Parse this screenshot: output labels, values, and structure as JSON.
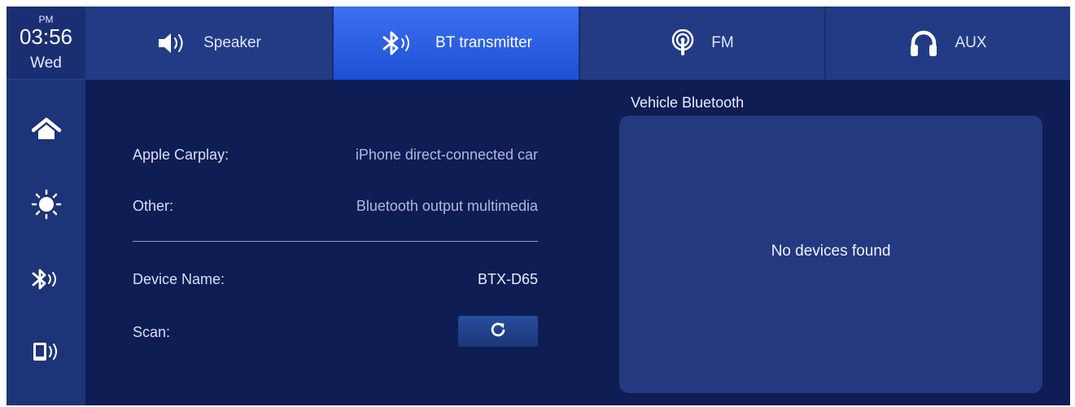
{
  "status": {
    "ampm": "PM",
    "time": "03:56",
    "day": "Wed"
  },
  "rail": {
    "items": [
      {
        "icon": "home-icon"
      },
      {
        "icon": "brightness-icon"
      },
      {
        "icon": "bluetooth-icon"
      },
      {
        "icon": "phone-audio-icon"
      }
    ]
  },
  "tabs": [
    {
      "label": "Speaker",
      "icon": "speaker-icon",
      "active": false
    },
    {
      "label": "BT transmitter",
      "icon": "bluetooth-icon",
      "active": true
    },
    {
      "label": "FM",
      "icon": "radio-icon",
      "active": false
    },
    {
      "label": "AUX",
      "icon": "headphones-icon",
      "active": false
    }
  ],
  "info": {
    "carplay_label": "Apple Carplay:",
    "carplay_value": "iPhone direct-connected car",
    "other_label": "Other:",
    "other_value": "Bluetooth output multimedia",
    "device_name_label": "Device Name:",
    "device_name_value": "BTX-D65",
    "scan_label": "Scan:",
    "scan_icon": "refresh-icon"
  },
  "vehicle_bluetooth": {
    "title": "Vehicle Bluetooth",
    "empty_message": "No devices found"
  },
  "colors": {
    "background": "#0f1d55",
    "rail": "#1e3478",
    "tab": "#233b85",
    "tab_active": "#2e5fe6",
    "panel": "#24397f"
  }
}
